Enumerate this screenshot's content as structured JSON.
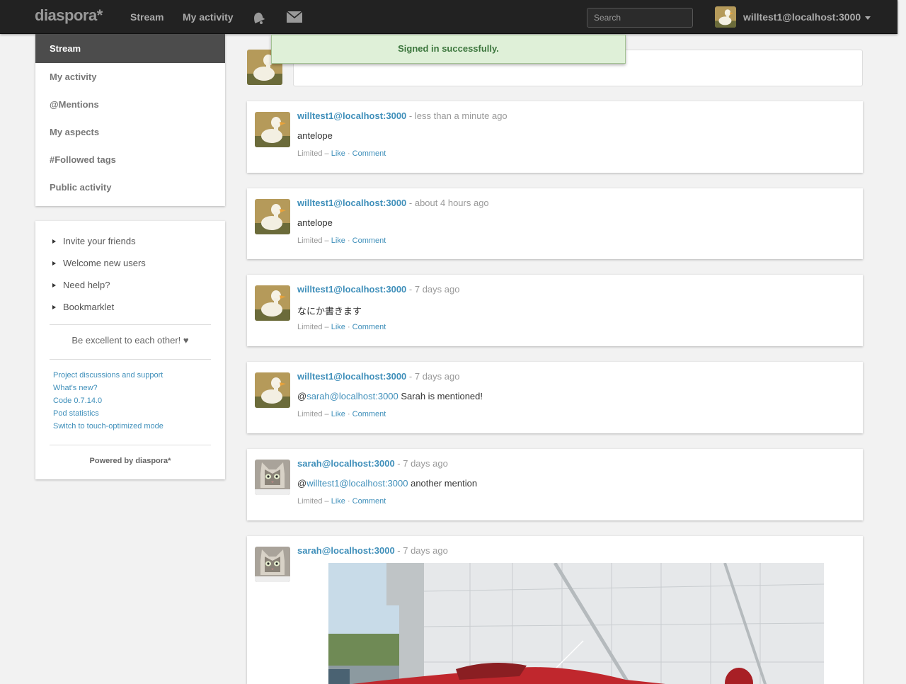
{
  "header": {
    "brand": "diaspora*",
    "nav": [
      "Stream",
      "My activity"
    ],
    "search_placeholder": "Search",
    "username": "willtest1@localhost:3000"
  },
  "flash": {
    "message": "Signed in successfully."
  },
  "sidebar": {
    "items": [
      {
        "label": "Stream",
        "active": true
      },
      {
        "label": "My activity"
      },
      {
        "label": "@Mentions"
      },
      {
        "label": "My aspects"
      },
      {
        "label": "#Followed tags"
      },
      {
        "label": "Public activity"
      }
    ]
  },
  "info": {
    "links": [
      "Invite your friends",
      "Welcome new users",
      "Need help?",
      "Bookmarklet"
    ],
    "motto": "Be excellent to each other! ♥",
    "footer_links": [
      "Project discussions and support",
      "What's new?",
      "Code 0.7.14.0",
      "Pod statistics",
      "Switch to touch-optimized mode"
    ],
    "powered": "Powered by diaspora*"
  },
  "posts": [
    {
      "author": "willtest1@localhost:3000",
      "time": " - less than a minute ago",
      "text": "antelope",
      "visibility": "Limited – ",
      "like": "Like",
      "comment": "Comment"
    },
    {
      "author": "willtest1@localhost:3000",
      "time": " - about 4 hours ago",
      "text": "antelope",
      "visibility": "Limited – ",
      "like": "Like",
      "comment": "Comment"
    },
    {
      "author": "willtest1@localhost:3000",
      "time": " - 7 days ago",
      "text": "なにか書きます",
      "visibility": "Limited – ",
      "like": "Like",
      "comment": "Comment"
    },
    {
      "author": "willtest1@localhost:3000",
      "time": " - 7 days ago",
      "mention_prefix": "@",
      "mention": "sarah@localhost:3000",
      "text": " Sarah is mentioned!",
      "visibility": "Limited – ",
      "like": "Like",
      "comment": "Comment"
    },
    {
      "author": "sarah@localhost:3000",
      "time": " - 7 days ago",
      "mention_prefix": "@",
      "mention": "willtest1@localhost:3000",
      "text": " another mention",
      "visibility": "Limited – ",
      "like": "Like",
      "comment": "Comment"
    },
    {
      "author": "sarah@localhost:3000",
      "time": " - 7 days ago"
    }
  ],
  "colors": {
    "link": "#3f8fba",
    "header_bg": "#222222",
    "flash_bg": "#dff0d8"
  }
}
